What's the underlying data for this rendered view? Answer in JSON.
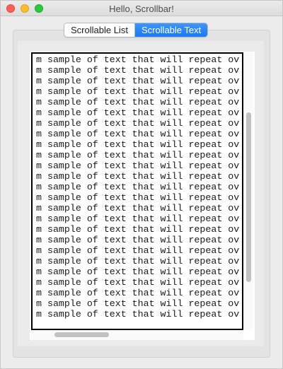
{
  "window": {
    "title": "Hello, Scrollbar!"
  },
  "tabs": [
    {
      "label": "Scrollable List",
      "active": false
    },
    {
      "label": "Scrollable Text",
      "active": true
    }
  ],
  "text_area": {
    "line_text": "m sample of text that will repeat ov",
    "visible_line_count": 25
  },
  "colors": {
    "accent": "#1b78f2",
    "close": "#fd5f57",
    "minimize": "#febc2e",
    "maximize": "#28c840"
  }
}
